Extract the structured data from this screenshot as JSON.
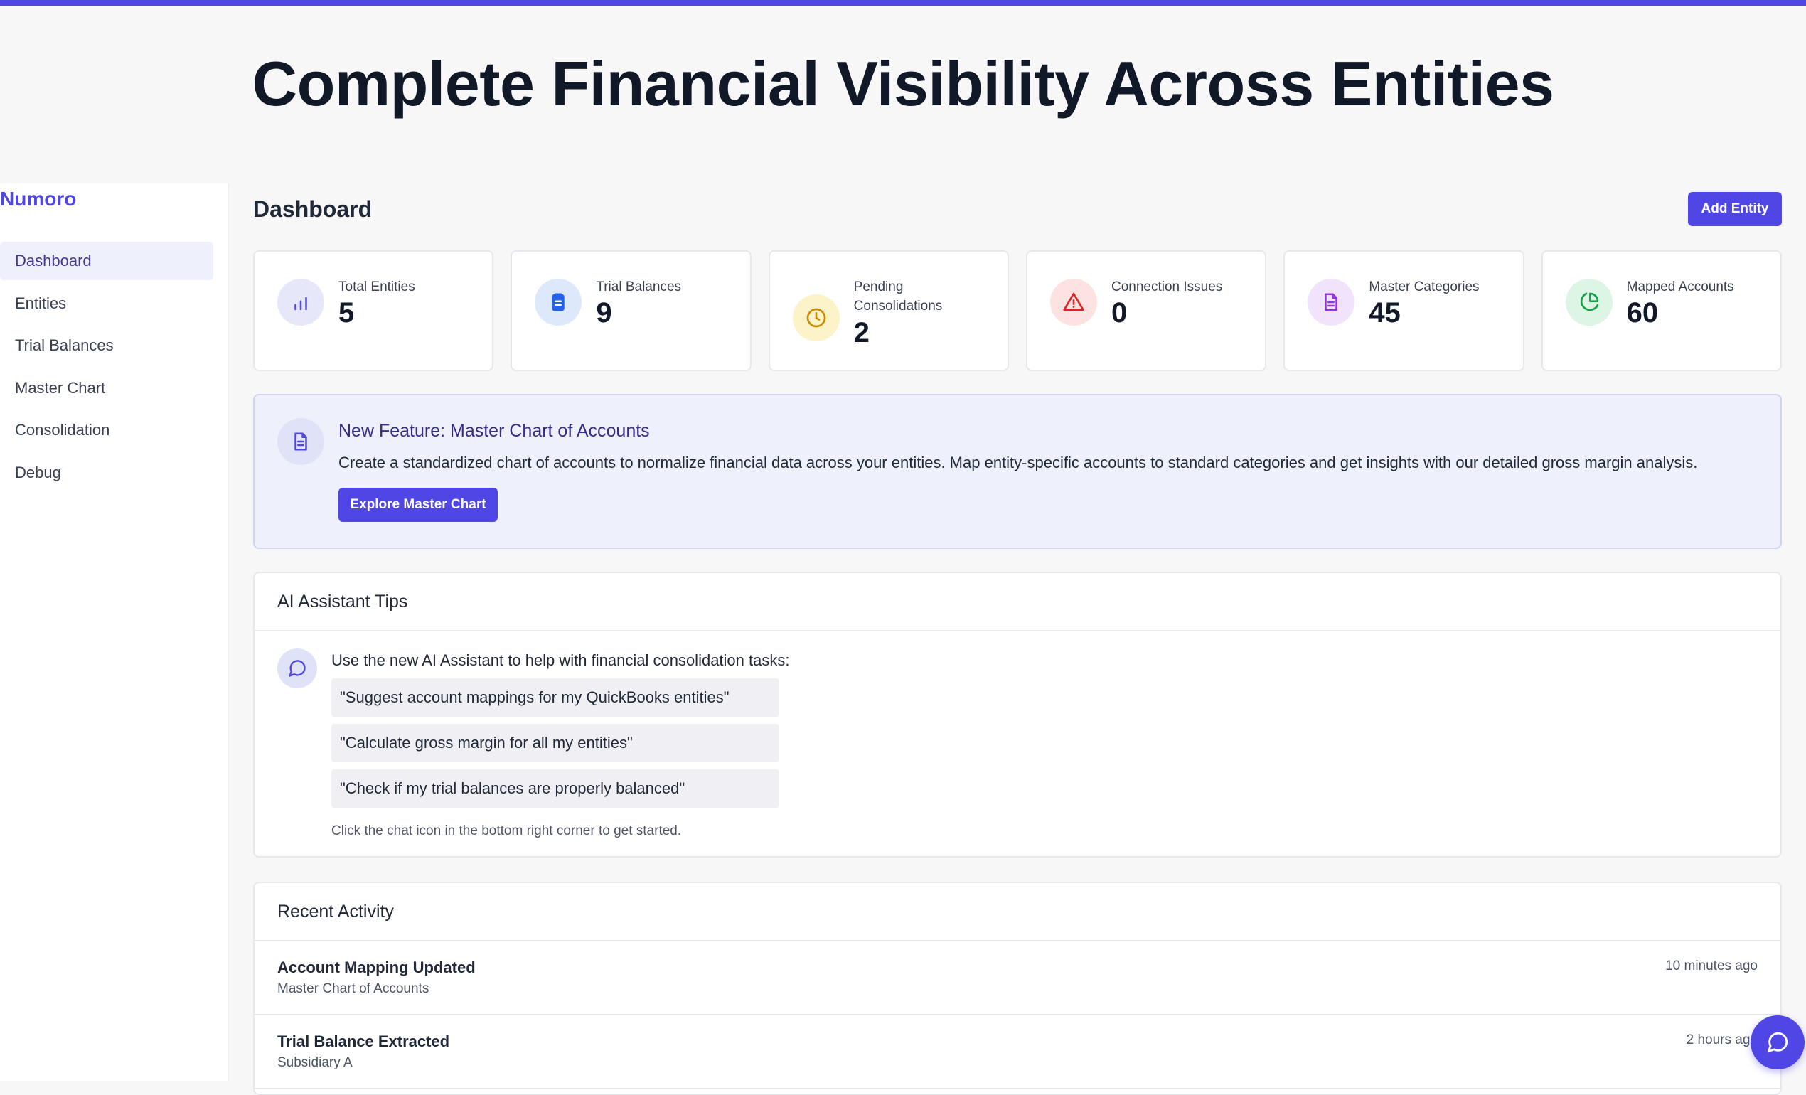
{
  "hero": {
    "title": "Complete Financial Visibility Across Entities"
  },
  "sidebar": {
    "brand": "Numoro",
    "items": [
      {
        "label": "Dashboard",
        "active": true
      },
      {
        "label": "Entities"
      },
      {
        "label": "Trial Balances"
      },
      {
        "label": "Master Chart"
      },
      {
        "label": "Consolidation"
      },
      {
        "label": "Debug"
      }
    ]
  },
  "header": {
    "title": "Dashboard",
    "add_entity_label": "Add Entity"
  },
  "stats": [
    {
      "label": "Total Entities",
      "value": "5",
      "icon": "bar-chart-icon",
      "color": "#4f46e5",
      "bg": "#e6e8fa"
    },
    {
      "label": "Trial Balances",
      "value": "9",
      "icon": "clipboard-icon",
      "color": "#2563eb",
      "bg": "#dde8fb"
    },
    {
      "label": "Pending Consolidations",
      "value": "2",
      "icon": "clock-icon",
      "color": "#ca8a04",
      "bg": "#fdf3c8"
    },
    {
      "label": "Connection Issues",
      "value": "0",
      "icon": "alert-triangle-icon",
      "color": "#dc2626",
      "bg": "#fde2e2"
    },
    {
      "label": "Master Categories",
      "value": "45",
      "icon": "document-icon",
      "color": "#9333ea",
      "bg": "#f1e3fb"
    },
    {
      "label": "Mapped Accounts",
      "value": "60",
      "icon": "pie-chart-icon",
      "color": "#16a34a",
      "bg": "#dcf5e4"
    }
  ],
  "feature": {
    "title": "New Feature: Master Chart of Accounts",
    "text": "Create a standardized chart of accounts to normalize financial data across your entities. Map entity-specific accounts to standard categories and get insights with our detailed gross margin analysis.",
    "button_label": "Explore Master Chart"
  },
  "tips": {
    "title": "AI Assistant Tips",
    "intro": "Use the new AI Assistant to help with financial consolidation tasks:",
    "items": [
      "\"Suggest account mappings for my QuickBooks entities\"",
      "\"Calculate gross margin for all my entities\"",
      "\"Check if my trial balances are properly balanced\""
    ],
    "footer": "Click the chat icon in the bottom right corner to get started."
  },
  "activity": {
    "title": "Recent Activity",
    "items": [
      {
        "title": "Account Mapping Updated",
        "subtitle": "Master Chart of Accounts",
        "time": "10 minutes ago"
      },
      {
        "title": "Trial Balance Extracted",
        "subtitle": "Subsidiary A",
        "time": "2 hours ago"
      }
    ]
  },
  "colors": {
    "accent": "#4f46e5"
  }
}
